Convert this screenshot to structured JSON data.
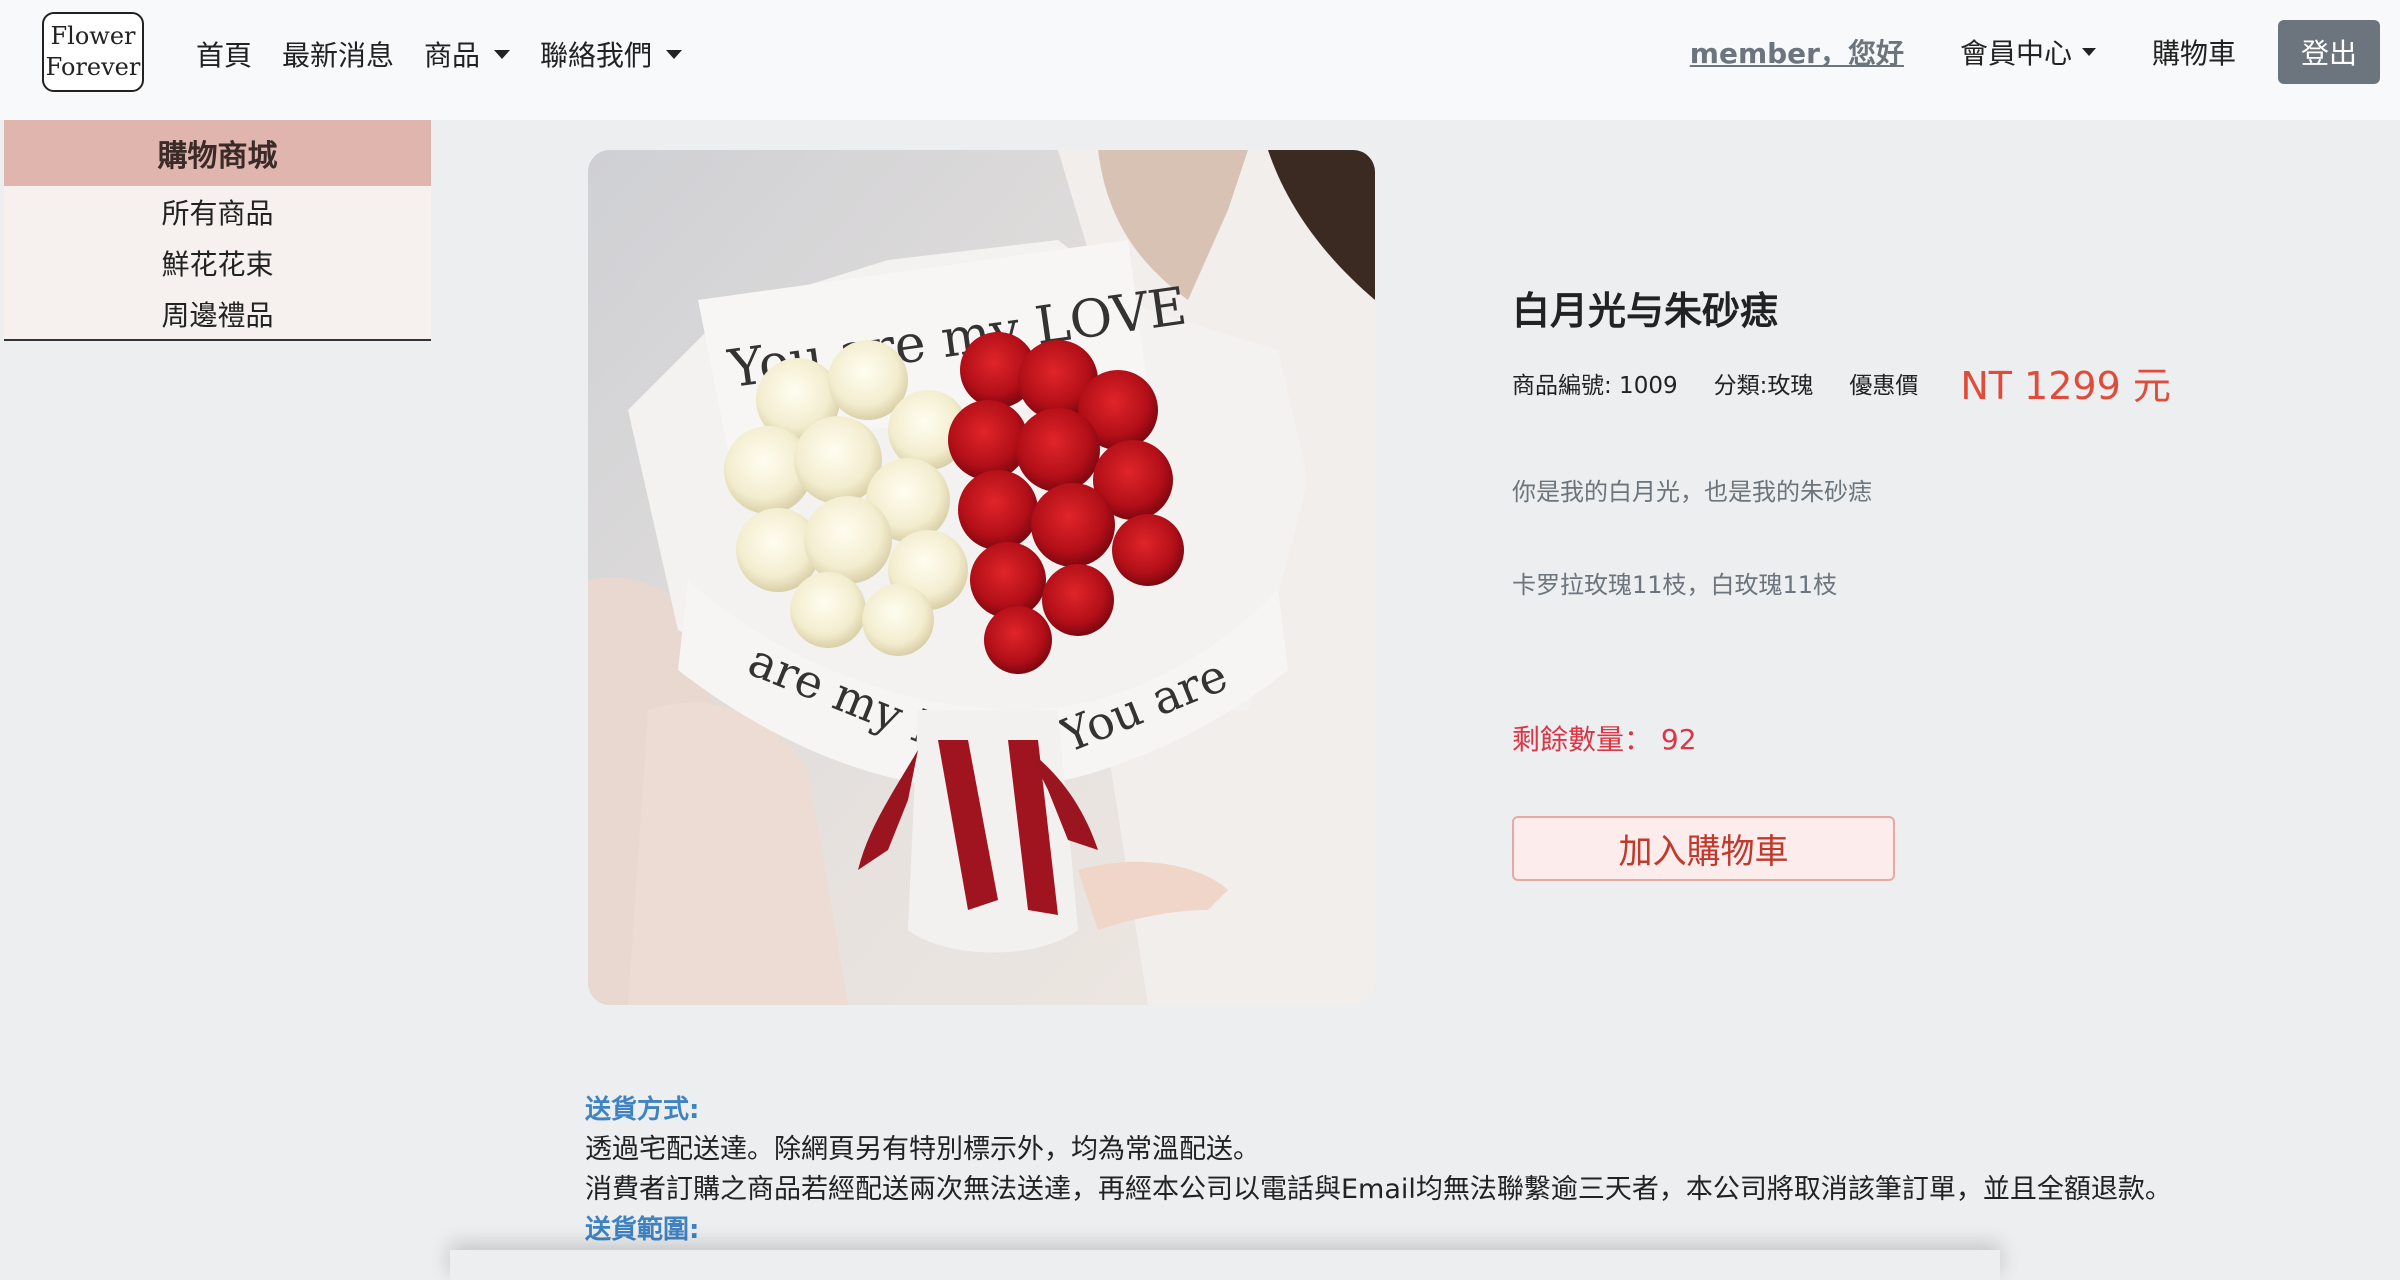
{
  "logo": {
    "line1": "Flower",
    "line2": "Forever"
  },
  "nav": {
    "home": "首頁",
    "news": "最新消息",
    "products": "商品",
    "contact": "聯絡我們",
    "greeting": "member，您好",
    "member_center": "會員中心",
    "cart": "購物車",
    "logout": "登出"
  },
  "sidebar": {
    "title": "購物商城",
    "items": [
      {
        "label": "所有商品"
      },
      {
        "label": "鮮花花束"
      },
      {
        "label": "周邊禮品"
      }
    ]
  },
  "product": {
    "image_icon": "bouquet-photo",
    "title": "白月光与朱砂痣",
    "id_label": "商品編號: 1009",
    "category_label": "分類:玫瑰",
    "discount_label": "優惠價",
    "price": "NT 1299 元",
    "desc1": "你是我的白月光，也是我的朱砂痣",
    "desc2": "卡罗拉玫瑰11枝，白玫瑰11枝",
    "stock": "剩餘數量：  92",
    "add_to_cart": "加入購物車",
    "ribbon_text": "You are my LOVE"
  },
  "delivery": {
    "method_heading": "送貨方式:",
    "method_line1": "透過宅配送達。除網頁另有特別標示外，均為常溫配送。",
    "method_line2": "消費者訂購之商品若經配送兩次無法送達，再經本公司以電話與Email均無法聯繫逾三天者，本公司將取消該筆訂單，並且全額退款。",
    "range_heading": "送貨範圍:"
  },
  "colors": {
    "accent_red": "#e14c3a",
    "sidebar_header": "#dfb5ae",
    "delivery_heading": "#3f83c3",
    "logout_bg": "#6c757d"
  }
}
